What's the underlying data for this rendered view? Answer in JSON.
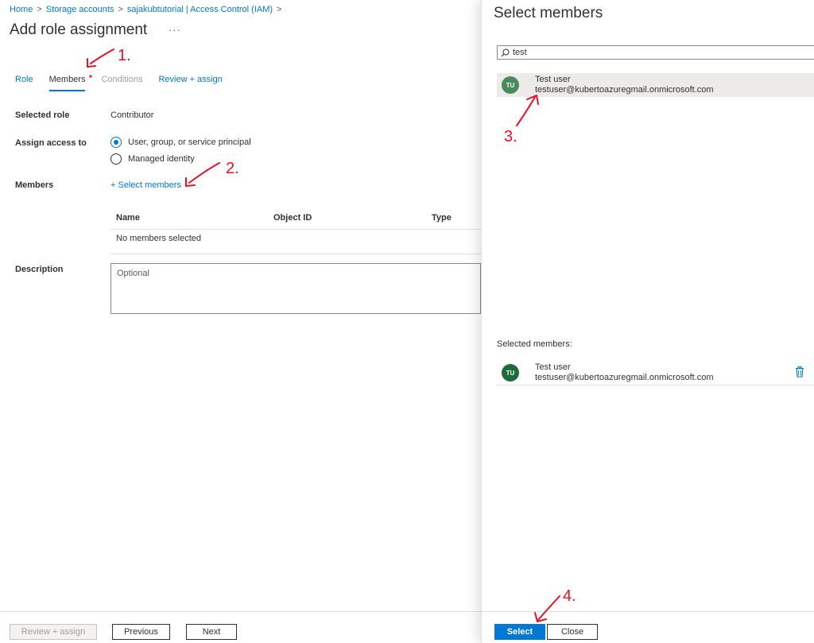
{
  "breadcrumb": {
    "items": [
      "Home",
      "Storage accounts",
      "sajakubtutorial | Access Control (IAM)"
    ],
    "trailing_sep": ">"
  },
  "page": {
    "title": "Add role assignment",
    "more_label": "···"
  },
  "tabs": [
    {
      "label": "Role",
      "state": "link"
    },
    {
      "label": "Members",
      "state": "active"
    },
    {
      "label": "Conditions",
      "state": "disabled"
    },
    {
      "label": "Review + assign",
      "state": "link"
    }
  ],
  "form": {
    "selected_role_label": "Selected role",
    "selected_role_value": "Contributor",
    "assign_access_label": "Assign access to",
    "assign_options": [
      {
        "label": "User, group, or service principal",
        "selected": true
      },
      {
        "label": "Managed identity",
        "selected": false
      }
    ],
    "members_label": "Members",
    "select_members_link": "+ Select members",
    "table_headers": [
      "Name",
      "Object ID",
      "Type"
    ],
    "table_empty": "No members selected",
    "description_label": "Description",
    "description_placeholder": "Optional"
  },
  "footer": {
    "review_assign": "Review + assign",
    "previous": "Previous",
    "next": "Next"
  },
  "panel": {
    "title": "Select members",
    "search_value": "test",
    "results": [
      {
        "initials": "TU",
        "name": "Test user",
        "email": "testuser@kubertoazuregmail.onmicrosoft.com"
      }
    ],
    "selected_label": "Selected members:",
    "selected": [
      {
        "initials": "TU",
        "name": "Test user",
        "email": "testuser@kubertoazuregmail.onmicrosoft.com"
      }
    ],
    "select_button": "Select",
    "close_button": "Close"
  },
  "annotations": [
    "1.",
    "2.",
    "3.",
    "4."
  ],
  "colors": {
    "accent": "#0078d4",
    "annotation": "#e81123",
    "avatar_result": "#4a8a5a",
    "avatar_selected": "#1e6b3a"
  },
  "icons": {
    "search": "search-icon",
    "trash": "trash-icon",
    "more": "more-icon"
  }
}
